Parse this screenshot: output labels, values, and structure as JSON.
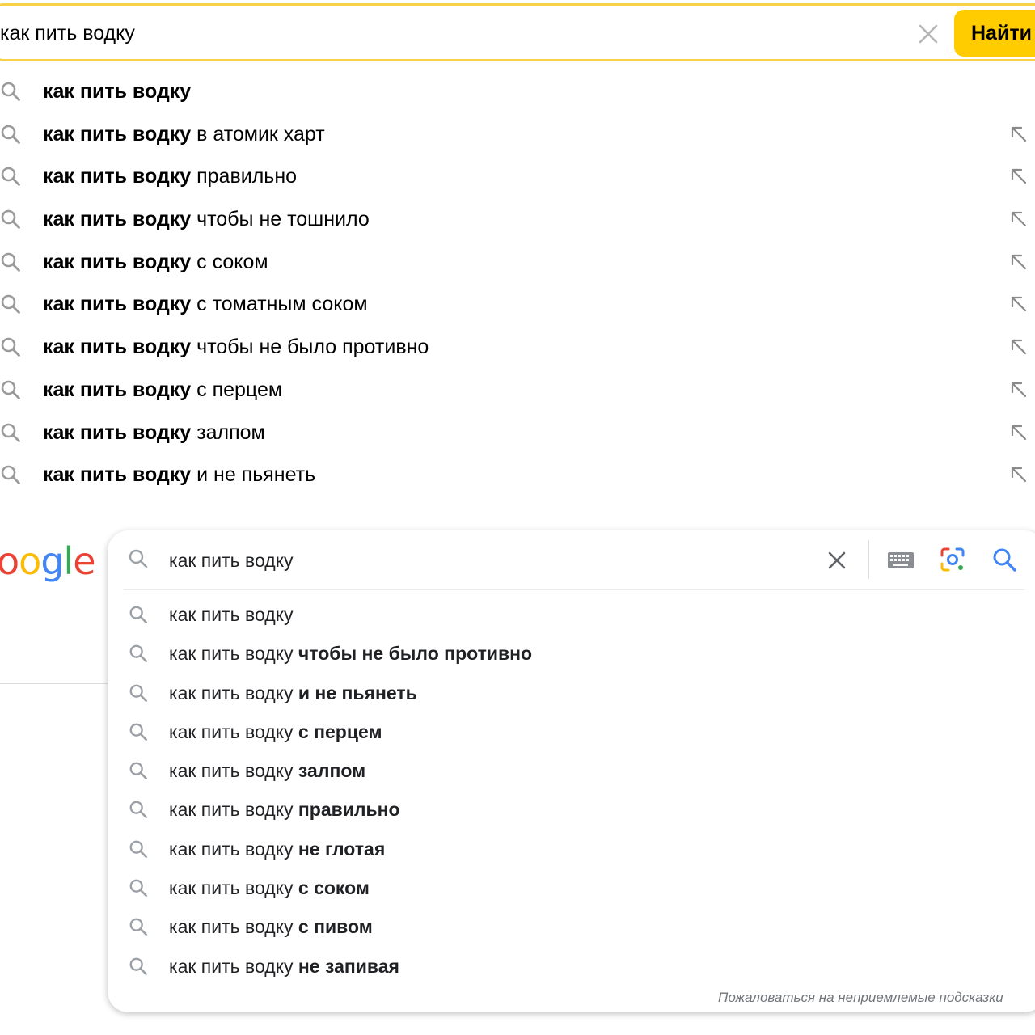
{
  "yandex": {
    "query": "как пить водку",
    "find_label": "Найти",
    "suggestions": [
      {
        "bold": "как пить водку",
        "rest": "",
        "arrow": false
      },
      {
        "bold": "как пить водку",
        "rest": " в атомик харт",
        "arrow": true
      },
      {
        "bold": "как пить водку",
        "rest": " правильно",
        "arrow": true
      },
      {
        "bold": "как пить водку",
        "rest": " чтобы не тошнило",
        "arrow": true
      },
      {
        "bold": "как пить водку",
        "rest": " с соком",
        "arrow": true
      },
      {
        "bold": "как пить водку",
        "rest": " с томатным соком",
        "arrow": true
      },
      {
        "bold": "как пить водку",
        "rest": " чтобы не было противно",
        "arrow": true
      },
      {
        "bold": "как пить водку",
        "rest": " с перцем",
        "arrow": true
      },
      {
        "bold": "как пить водку",
        "rest": " залпом",
        "arrow": true
      },
      {
        "bold": "как пить водку",
        "rest": " и не пьянеть",
        "arrow": true
      }
    ],
    "colors": {
      "accent": "#ffcc00",
      "border": "#f7d147"
    }
  },
  "google": {
    "logo_text": "oogle",
    "query": "как пить водку",
    "suggestions": [
      {
        "plain": "как пить водку",
        "bold": ""
      },
      {
        "plain": "как пить водку ",
        "bold": "чтобы не было противно"
      },
      {
        "plain": "как пить водку ",
        "bold": "и не пьянеть"
      },
      {
        "plain": "как пить водку ",
        "bold": "с перцем"
      },
      {
        "plain": "как пить водку ",
        "bold": "залпом"
      },
      {
        "plain": "как пить водку ",
        "bold": "правильно"
      },
      {
        "plain": "как пить водку ",
        "bold": "не глотая"
      },
      {
        "plain": "как пить водку ",
        "bold": "с соком"
      },
      {
        "plain": "как пить водку ",
        "bold": "с пивом"
      },
      {
        "plain": "как пить водку ",
        "bold": "не запивая"
      }
    ],
    "report_link": "Пожаловаться на неприемлемые подсказки",
    "icons": [
      "search-icon",
      "clear-icon",
      "keyboard-icon",
      "lens-icon",
      "search-submit-icon"
    ],
    "colors": {
      "blue": "#4285f4",
      "red": "#ea4335",
      "yellow": "#fbbc05",
      "green": "#34a853"
    }
  }
}
